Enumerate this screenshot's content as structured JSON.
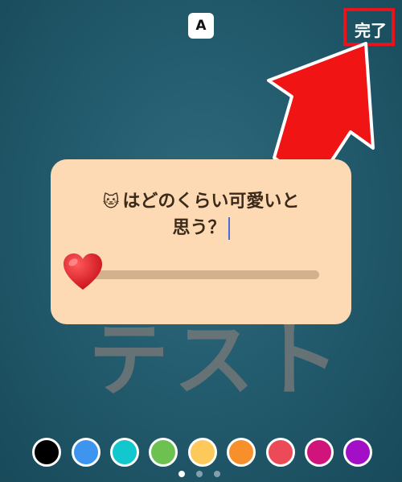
{
  "toolbar": {
    "font_toggle_label": "A",
    "done_label": "完了"
  },
  "background_text": "テスト",
  "sticker": {
    "question_emoji": "🐱",
    "question_line1": "はどのくらい可愛いと",
    "question_line2": "思う？",
    "slider_emoji": "heart-icon",
    "slider_value": 0
  },
  "palette": {
    "colors": [
      "#000000",
      "#3d95f0",
      "#12c7cd",
      "#6cc150",
      "#fcc95a",
      "#f7902a",
      "#ed4a57",
      "#d1137c",
      "#a30fc6"
    ]
  },
  "page_indicator": {
    "pages": 3,
    "current": 1
  },
  "annotation": {
    "highlight_color": "#e8141c"
  }
}
